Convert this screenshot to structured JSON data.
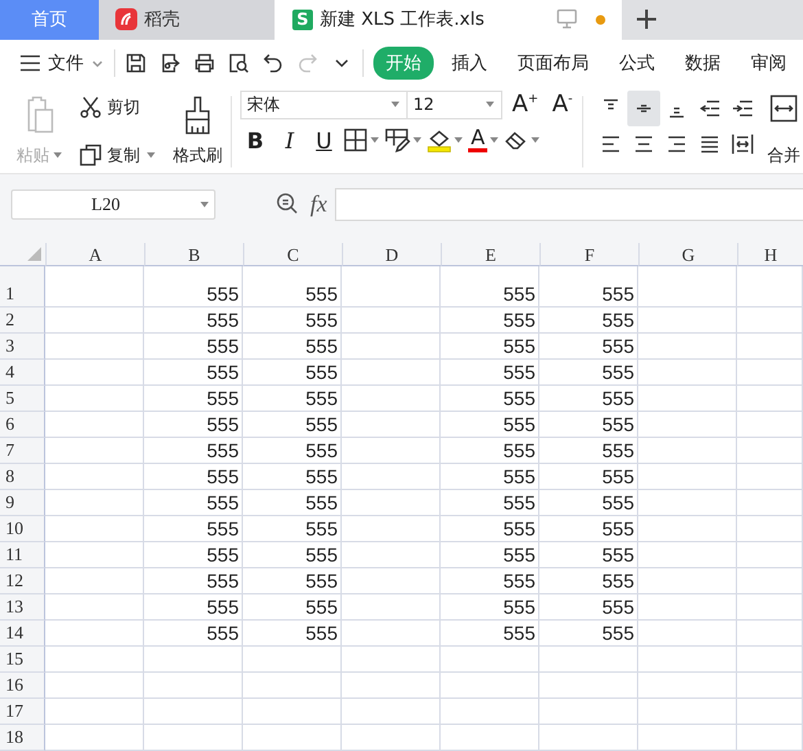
{
  "window_tabs": [
    {
      "label": "首页",
      "kind": "home",
      "selected": false
    },
    {
      "label": "稻壳",
      "kind": "docer",
      "selected": false
    },
    {
      "label": "新建 XLS 工作表.xls",
      "kind": "sheet",
      "badge": "S",
      "selected": true,
      "unsaved": true
    }
  ],
  "menu": {
    "file": "文件",
    "quick_access": [
      {
        "kind": "save",
        "disabled": false
      },
      {
        "kind": "export",
        "disabled": false
      },
      {
        "kind": "print",
        "disabled": false
      },
      {
        "kind": "preview",
        "disabled": false
      },
      {
        "kind": "undo",
        "disabled": false
      },
      {
        "kind": "redo",
        "disabled": true
      },
      {
        "kind": "more",
        "disabled": false
      }
    ],
    "tabs": [
      {
        "label": "开始",
        "selected": true
      },
      {
        "label": "插入",
        "selected": false
      },
      {
        "label": "页面布局",
        "selected": false
      },
      {
        "label": "公式",
        "selected": false
      },
      {
        "label": "数据",
        "selected": false
      },
      {
        "label": "审阅",
        "selected": false
      }
    ]
  },
  "ribbon": {
    "paste": {
      "label": "粘贴",
      "disabled": true
    },
    "cut": "剪切",
    "copy": "复制",
    "format_painter": "格式刷",
    "font": "宋体",
    "size": "12",
    "grow": "A$^{+}$",
    "shrink": "A$^{-}$",
    "bold": "B",
    "italic": "I",
    "underline": "U",
    "font_color": "A",
    "align": [
      {
        "kind": "top",
        "selected": false
      },
      {
        "kind": "middle",
        "selected": true
      },
      {
        "kind": "bottom",
        "selected": false
      },
      {
        "kind": "outdent",
        "selected": false
      },
      {
        "kind": "indent",
        "selected": false
      },
      {
        "kind": "left",
        "selected": false
      },
      {
        "kind": "center",
        "selected": false
      },
      {
        "kind": "right",
        "selected": false
      },
      {
        "kind": "justify",
        "selected": false
      },
      {
        "kind": "distribute",
        "selected": false
      }
    ],
    "merge": "合并"
  },
  "formula_bar": {
    "name_box": "L20",
    "fx": "fx"
  },
  "sheet": {
    "columns": [
      "A",
      "B",
      "C",
      "D",
      "E",
      "F",
      "G",
      "H"
    ],
    "rows": [
      {
        "header": "1",
        "tall": true,
        "cells": [
          null,
          "555",
          "555",
          null,
          "555",
          "555",
          null,
          null
        ]
      },
      {
        "header": "2",
        "tall": false,
        "cells": [
          null,
          "555",
          "555",
          null,
          "555",
          "555",
          null,
          null
        ]
      },
      {
        "header": "3",
        "tall": false,
        "cells": [
          null,
          "555",
          "555",
          null,
          "555",
          "555",
          null,
          null
        ]
      },
      {
        "header": "4",
        "tall": false,
        "cells": [
          null,
          "555",
          "555",
          null,
          "555",
          "555",
          null,
          null
        ]
      },
      {
        "header": "5",
        "tall": false,
        "cells": [
          null,
          "555",
          "555",
          null,
          "555",
          "555",
          null,
          null
        ]
      },
      {
        "header": "6",
        "tall": false,
        "cells": [
          null,
          "555",
          "555",
          null,
          "555",
          "555",
          null,
          null
        ]
      },
      {
        "header": "7",
        "tall": false,
        "cells": [
          null,
          "555",
          "555",
          null,
          "555",
          "555",
          null,
          null
        ]
      },
      {
        "header": "8",
        "tall": false,
        "cells": [
          null,
          "555",
          "555",
          null,
          "555",
          "555",
          null,
          null
        ]
      },
      {
        "header": "9",
        "tall": false,
        "cells": [
          null,
          "555",
          "555",
          null,
          "555",
          "555",
          null,
          null
        ]
      },
      {
        "header": "10",
        "tall": false,
        "cells": [
          null,
          "555",
          "555",
          null,
          "555",
          "555",
          null,
          null
        ]
      },
      {
        "header": "11",
        "tall": false,
        "cells": [
          null,
          "555",
          "555",
          null,
          "555",
          "555",
          null,
          null
        ]
      },
      {
        "header": "12",
        "tall": false,
        "cells": [
          null,
          "555",
          "555",
          null,
          "555",
          "555",
          null,
          null
        ]
      },
      {
        "header": "13",
        "tall": false,
        "cells": [
          null,
          "555",
          "555",
          null,
          "555",
          "555",
          null,
          null
        ]
      },
      {
        "header": "14",
        "tall": false,
        "cells": [
          null,
          "555",
          "555",
          null,
          "555",
          "555",
          null,
          null
        ]
      },
      {
        "header": "15",
        "tall": false
      },
      {
        "header": "16",
        "tall": false
      },
      {
        "header": "17",
        "tall": false
      },
      {
        "header": "18",
        "tall": false
      }
    ]
  }
}
